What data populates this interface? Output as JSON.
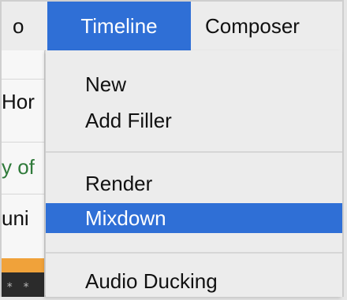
{
  "menubar": {
    "left_partial": "o",
    "timeline": "Timeline",
    "composer": "Composer"
  },
  "background": {
    "row1": "Hor",
    "row2": "y of",
    "row3": "uni",
    "toolbar_dots": "* *"
  },
  "dropdown": {
    "items": [
      {
        "label": "New"
      },
      {
        "label": "Add Filler"
      },
      {
        "label": "Render"
      },
      {
        "label": "Mixdown"
      },
      {
        "label": "Audio Ducking"
      }
    ],
    "highlighted_color": "#2f6fd6"
  }
}
